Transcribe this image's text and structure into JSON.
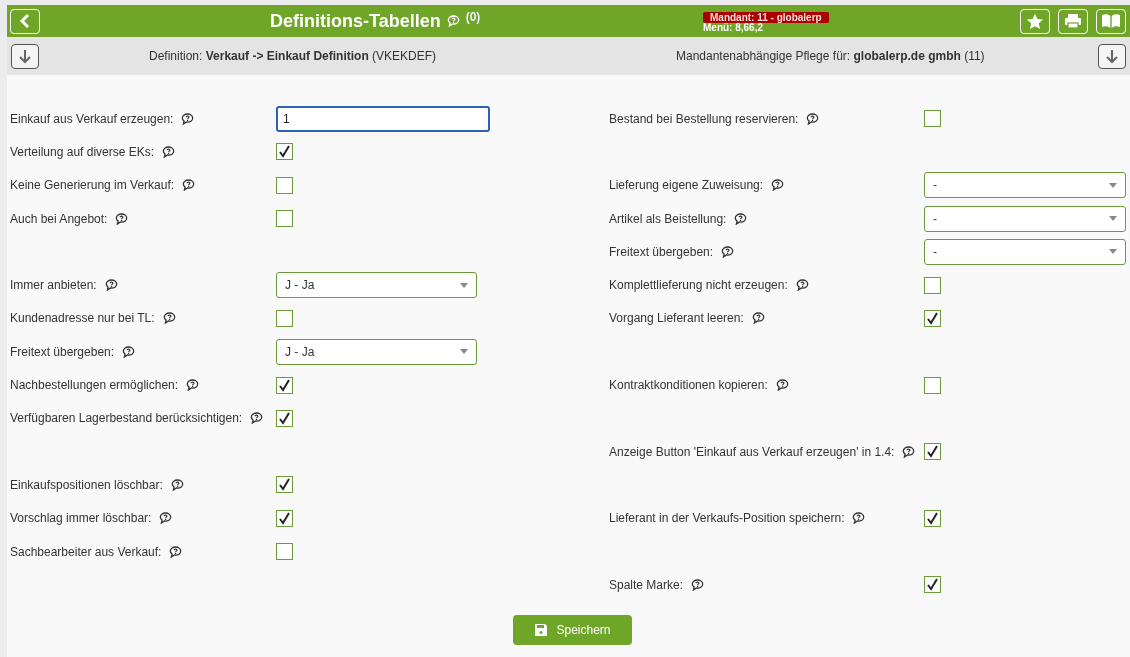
{
  "header": {
    "title": "Definitions-Tabellen",
    "help_count": "(0)",
    "mandant_badge": "Mandant: 11 - globalerp",
    "menu_info": "Menü: 8,66,2"
  },
  "subheader": {
    "definition_label": "Definition:",
    "definition_name": "Verkauf -> Einkauf Definition",
    "definition_code": "(VKEKDEF)",
    "maintenance_label": "Mandantenabhängige Pflege für:",
    "maintenance_company": "globalerp.de gmbh",
    "maintenance_code": "(11)"
  },
  "rows": [
    {
      "left": {
        "kind": "input",
        "label": "Einkauf aus Verkauf erzeugen:",
        "value": "1"
      },
      "right": {
        "kind": "checkbox",
        "label": "Bestand bei Bestellung reservieren:",
        "checked": false
      }
    },
    {
      "left": {
        "kind": "checkbox",
        "label": "Verteilung auf diverse EKs:",
        "checked": true
      },
      "right": null
    },
    {
      "left": {
        "kind": "checkbox",
        "label": "Keine Generierung im Verkauf:",
        "checked": false
      },
      "right": {
        "kind": "select",
        "label": "Lieferung eigene Zuweisung:",
        "value": "-"
      }
    },
    {
      "left": {
        "kind": "checkbox",
        "label": "Auch bei Angebot:",
        "checked": false
      },
      "right": {
        "kind": "select",
        "label": "Artikel als Beistellung:",
        "value": "-"
      }
    },
    {
      "left": null,
      "right": {
        "kind": "select",
        "label": "Freitext übergeben:",
        "value": "-"
      }
    },
    {
      "left": {
        "kind": "select",
        "label": "Immer anbieten:",
        "value": "J - Ja"
      },
      "right": {
        "kind": "checkbox",
        "label": "Komplettlieferung nicht erzeugen:",
        "checked": false
      }
    },
    {
      "left": {
        "kind": "checkbox",
        "label": "Kundenadresse nur bei TL:",
        "checked": false
      },
      "right": {
        "kind": "checkbox",
        "label": "Vorgang Lieferant leeren:",
        "checked": true
      }
    },
    {
      "left": {
        "kind": "select",
        "label": "Freitext übergeben:",
        "value": "J - Ja"
      },
      "right": null
    },
    {
      "left": {
        "kind": "checkbox",
        "label": "Nachbestellungen ermöglichen:",
        "checked": true
      },
      "right": {
        "kind": "checkbox",
        "label": "Kontraktkonditionen kopieren:",
        "checked": false
      }
    },
    {
      "left": {
        "kind": "checkbox",
        "label": "Verfügbaren Lagerbestand berücksichtigen:",
        "checked": true
      },
      "right": null
    },
    {
      "left": null,
      "right": {
        "kind": "checkbox",
        "label": "Anzeige Button 'Einkauf aus Verkauf erzeugen' in 1.4:",
        "checked": true
      }
    },
    {
      "left": {
        "kind": "checkbox",
        "label": "Einkaufspositionen löschbar:",
        "checked": true
      },
      "right": null
    },
    {
      "left": {
        "kind": "checkbox",
        "label": "Vorschlag immer löschbar:",
        "checked": true
      },
      "right": {
        "kind": "checkbox",
        "label": "Lieferant in der Verkaufs-Position speichern:",
        "checked": true
      }
    },
    {
      "left": {
        "kind": "checkbox",
        "label": "Sachbearbeiter aus Verkauf:",
        "checked": false
      },
      "right": null
    },
    {
      "left": null,
      "right": {
        "kind": "checkbox",
        "label": "Spalte Marke:",
        "checked": true
      }
    }
  ],
  "save_button": "Speichern"
}
